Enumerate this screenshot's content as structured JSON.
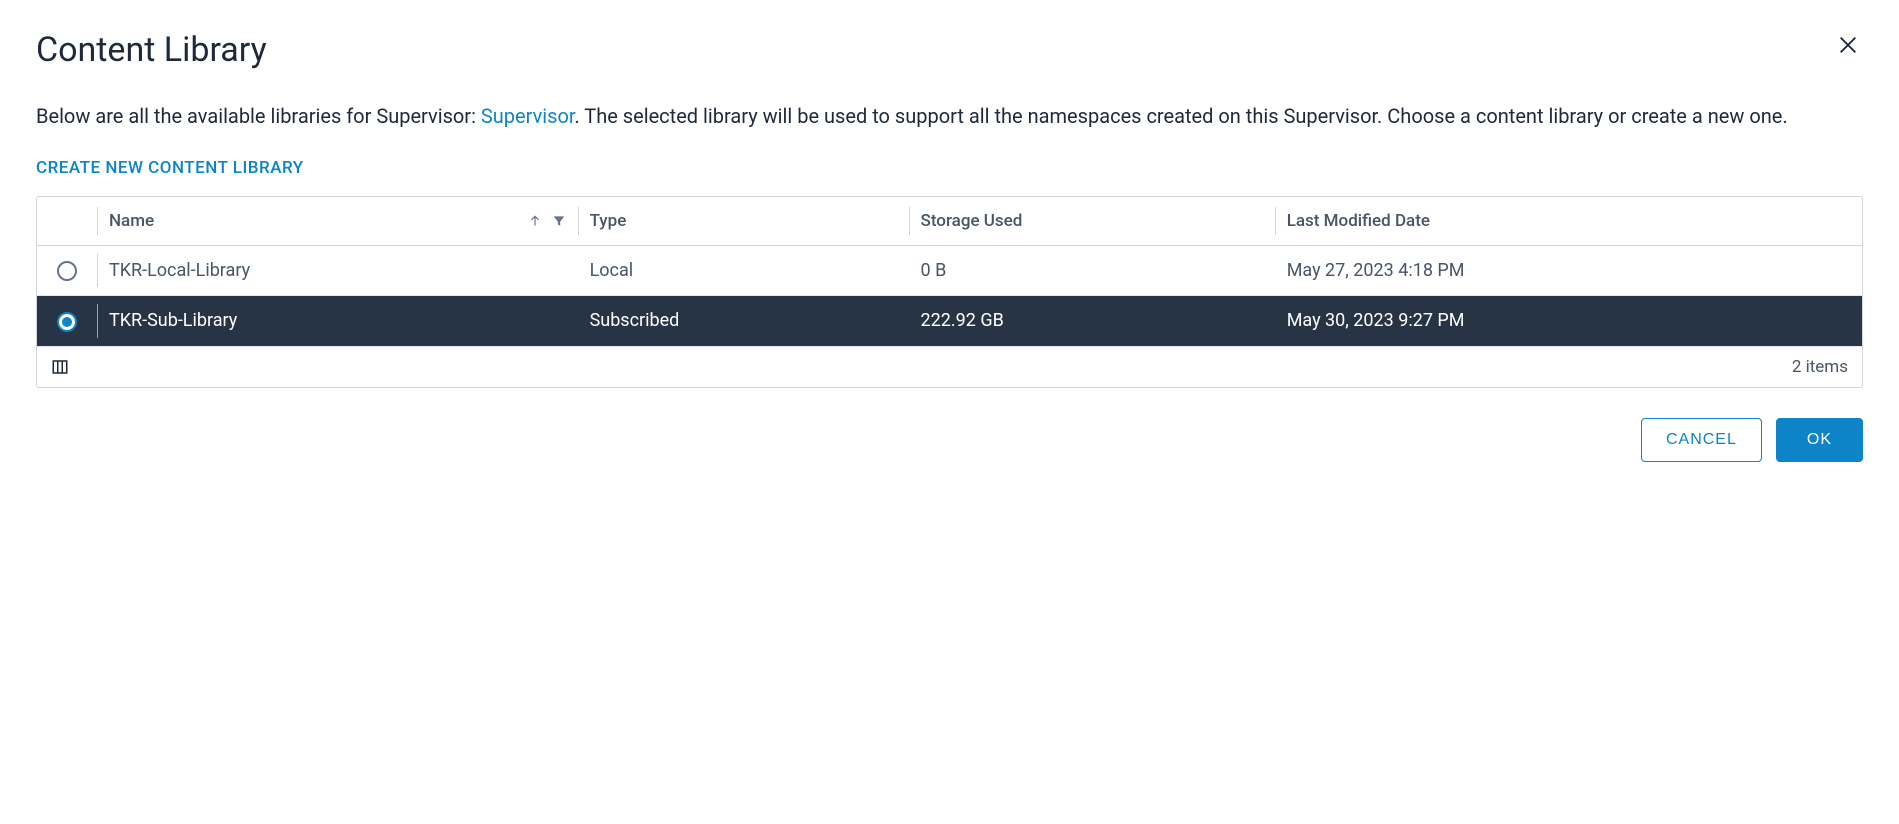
{
  "dialog": {
    "title": "Content Library",
    "description_before": "Below are all the available libraries for Supervisor: ",
    "supervisor_link": "Supervisor",
    "description_after": ". The selected library will be used to support all the namespaces created on this Supervisor. Choose a content library or create a new one.",
    "create_link": "CREATE NEW CONTENT LIBRARY"
  },
  "table": {
    "columns": {
      "name": "Name",
      "type": "Type",
      "storage": "Storage Used",
      "modified": "Last Modified Date"
    },
    "rows": [
      {
        "selected": false,
        "name": "TKR-Local-Library",
        "type": "Local",
        "storage": "0 B",
        "modified": "May 27, 2023 4:18 PM"
      },
      {
        "selected": true,
        "name": "TKR-Sub-Library",
        "type": "Subscribed",
        "storage": "222.92 GB",
        "modified": "May 30, 2023 9:27 PM"
      }
    ],
    "footer_count": "2 items"
  },
  "buttons": {
    "cancel": "CANCEL",
    "ok": "OK"
  }
}
